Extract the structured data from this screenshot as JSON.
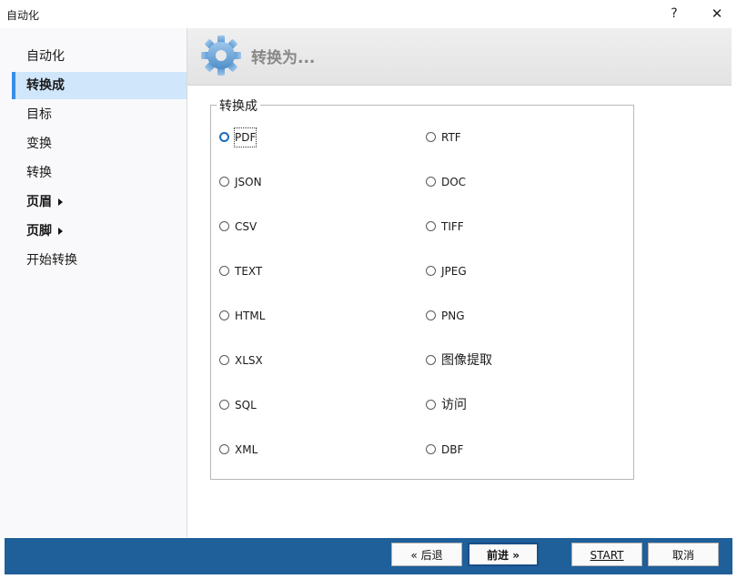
{
  "window": {
    "title": "自动化",
    "help_label": "?",
    "close_label": "✕"
  },
  "sidebar": {
    "items": [
      {
        "label": "自动化"
      },
      {
        "label": "转换成"
      },
      {
        "label": "目标"
      },
      {
        "label": "变换"
      },
      {
        "label": "转换"
      },
      {
        "label": "页眉"
      },
      {
        "label": "页脚"
      },
      {
        "label": "开始转换"
      }
    ],
    "selected_index": 1
  },
  "header": {
    "title": "转换为...",
    "icon": "gear-icon"
  },
  "group": {
    "legend": "转换成",
    "left_options": [
      {
        "label": "PDF"
      },
      {
        "label": "JSON"
      },
      {
        "label": "CSV"
      },
      {
        "label": "TEXT"
      },
      {
        "label": "HTML"
      },
      {
        "label": "XLSX"
      },
      {
        "label": "SQL"
      },
      {
        "label": "XML"
      }
    ],
    "right_options": [
      {
        "label": "RTF"
      },
      {
        "label": "DOC"
      },
      {
        "label": "TIFF"
      },
      {
        "label": "JPEG"
      },
      {
        "label": "PNG"
      },
      {
        "label": "图像提取"
      },
      {
        "label": "访问"
      },
      {
        "label": "DBF"
      }
    ],
    "focused_option": "PDF"
  },
  "footer": {
    "back_label": "« 后退",
    "next_label": "前进 »",
    "start_label": "START",
    "cancel_label": "取消"
  },
  "colors": {
    "footer_bg": "#1f5f9a",
    "selected_bg": "#cfe6fb",
    "selected_accent": "#3a8ee6",
    "radio_focus": "#1b6cc4"
  }
}
